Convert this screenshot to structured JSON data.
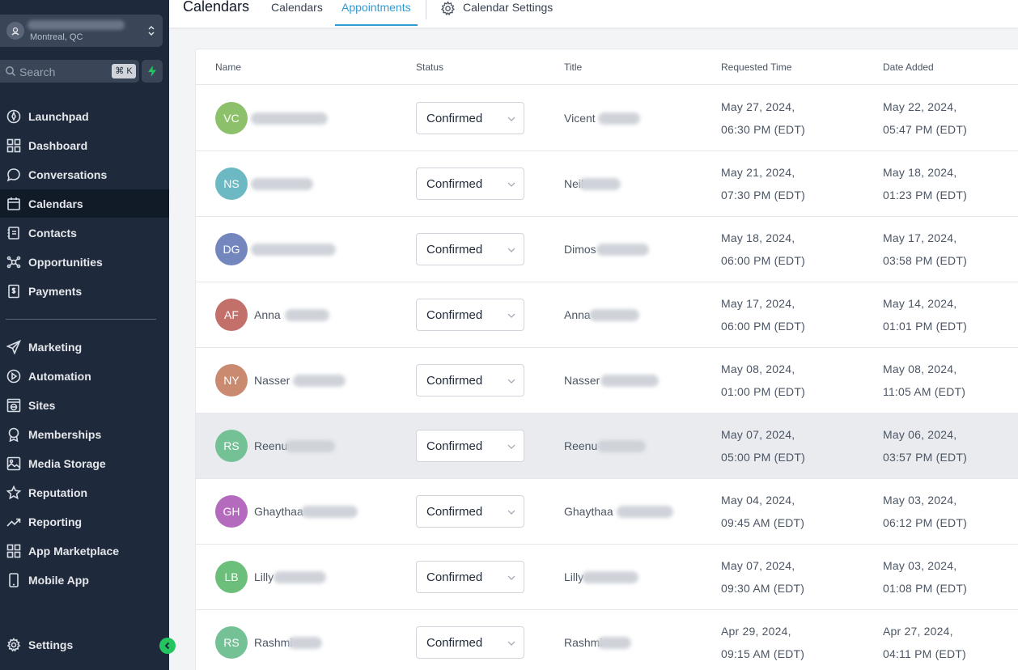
{
  "sidebar": {
    "location": {
      "city": "Montreal, QC"
    },
    "search": {
      "placeholder": "Search",
      "shortcut": "⌘ K"
    },
    "items": [
      {
        "label": "Launchpad",
        "icon": "rocket-icon"
      },
      {
        "label": "Dashboard",
        "icon": "grid-icon"
      },
      {
        "label": "Conversations",
        "icon": "chat-bubble-icon"
      },
      {
        "label": "Calendars",
        "icon": "calendar-icon",
        "active": true
      },
      {
        "label": "Contacts",
        "icon": "contact-book-icon"
      },
      {
        "label": "Opportunities",
        "icon": "network-icon"
      },
      {
        "label": "Payments",
        "icon": "dollar-receipt-icon"
      }
    ],
    "items2": [
      {
        "label": "Marketing",
        "icon": "send-icon"
      },
      {
        "label": "Automation",
        "icon": "play-circle-icon"
      },
      {
        "label": "Sites",
        "icon": "globe-icon"
      },
      {
        "label": "Memberships",
        "icon": "award-icon"
      },
      {
        "label": "Media Storage",
        "icon": "image-icon"
      },
      {
        "label": "Reputation",
        "icon": "star-icon"
      },
      {
        "label": "Reporting",
        "icon": "trend-up-icon"
      },
      {
        "label": "App Marketplace",
        "icon": "apps-grid-icon"
      },
      {
        "label": "Mobile App",
        "icon": "phone-icon"
      }
    ],
    "settings": {
      "label": "Settings",
      "icon": "gear-icon"
    }
  },
  "header": {
    "title": "Calendars",
    "tabs": [
      {
        "label": "Calendars",
        "active": false
      },
      {
        "label": "Appointments",
        "active": true
      },
      {
        "label": "Calendar Settings",
        "active": false
      }
    ]
  },
  "table": {
    "columns": [
      "Name",
      "Status",
      "Title",
      "Requested Time",
      "Date Added"
    ],
    "rows": [
      {
        "initials": "VC",
        "color": "#8cc06a",
        "name": "",
        "status": "Confirmed",
        "title": "Vicent",
        "req1": "May 27, 2024,",
        "req2": "06:30 PM (EDT)",
        "add1": "May 22, 2024,",
        "add2": "05:47 PM (EDT)"
      },
      {
        "initials": "NS",
        "color": "#6cb8c3",
        "name": "",
        "status": "Confirmed",
        "title": "Neil",
        "req1": "May 21, 2024,",
        "req2": "07:30 PM (EDT)",
        "add1": "May 18, 2024,",
        "add2": "01:23 PM (EDT)"
      },
      {
        "initials": "DG",
        "color": "#7386bd",
        "name": "",
        "status": "Confirmed",
        "title": "Dimos",
        "req1": "May 18, 2024,",
        "req2": "06:00 PM (EDT)",
        "add1": "May 17, 2024,",
        "add2": "03:58 PM (EDT)"
      },
      {
        "initials": "AF",
        "color": "#c4706a",
        "name": "Anna",
        "status": "Confirmed",
        "title": "Anna",
        "req1": "May 17, 2024,",
        "req2": "06:00 PM (EDT)",
        "add1": "May 14, 2024,",
        "add2": "01:01 PM (EDT)"
      },
      {
        "initials": "NY",
        "color": "#c98a6f",
        "name": "Nasser",
        "status": "Confirmed",
        "title": "Nasser",
        "req1": "May 08, 2024,",
        "req2": "01:00 PM (EDT)",
        "add1": "May 08, 2024,",
        "add2": "11:05 AM (EDT)"
      },
      {
        "initials": "RS",
        "color": "#74c196",
        "name": "Reenu",
        "status": "Confirmed",
        "title": "Reenu",
        "req1": "May 07, 2024,",
        "req2": "05:00 PM (EDT)",
        "add1": "May 06, 2024,",
        "add2": "03:57 PM (EDT)",
        "highlight": true
      },
      {
        "initials": "GH",
        "color": "#b56bbd",
        "name": "Ghaythaa",
        "status": "Confirmed",
        "title": "Ghaythaa",
        "req1": "May 04, 2024,",
        "req2": "09:45 AM (EDT)",
        "add1": "May 03, 2024,",
        "add2": "06:12 PM (EDT)"
      },
      {
        "initials": "LB",
        "color": "#6cbf7a",
        "name": "Lilly",
        "status": "Confirmed",
        "title": "Lilly",
        "req1": "May 07, 2024,",
        "req2": "09:30 AM (EDT)",
        "add1": "May 03, 2024,",
        "add2": "01:08 PM (EDT)"
      },
      {
        "initials": "RS",
        "color": "#74c196",
        "name": "Rashmi",
        "status": "Confirmed",
        "title": "Rashmi",
        "req1": "Apr 29, 2024,",
        "req2": "09:15 AM (EDT)",
        "add1": "Apr 27, 2024,",
        "add2": "04:11 PM (EDT)"
      }
    ]
  }
}
